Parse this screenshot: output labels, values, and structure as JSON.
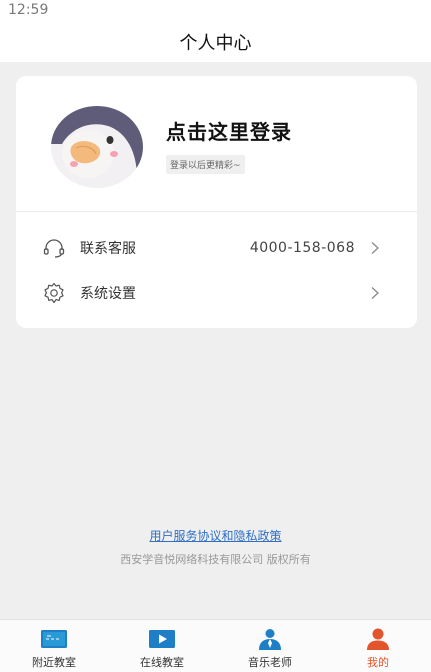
{
  "status_bar": {
    "time": "12:59"
  },
  "header": {
    "title": "个人中心"
  },
  "profile": {
    "login_prompt": "点击这里登录",
    "login_subtitle": "登录以后更精彩~"
  },
  "menu": {
    "service": {
      "label": "联系客服",
      "value": "4000-158-068",
      "icon": "headset-icon"
    },
    "settings": {
      "label": "系统设置",
      "icon": "gear-icon"
    }
  },
  "footer": {
    "agreement_link": "用户服务协议和隐私政策",
    "copyright": "西安学音悦网络科技有限公司 版权所有"
  },
  "tabbar": {
    "tabs": [
      {
        "label": "附近教室",
        "icon": "classroom-icon",
        "active": false
      },
      {
        "label": "在线教室",
        "icon": "play-video-icon",
        "active": false
      },
      {
        "label": "音乐老师",
        "icon": "teacher-icon",
        "active": false
      },
      {
        "label": "我的",
        "icon": "user-icon",
        "active": true
      }
    ]
  },
  "colors": {
    "accent": "#e2542b",
    "link": "#2f6fc4",
    "tab_icon_blue": "#1f7fc6",
    "background": "#efefef"
  }
}
